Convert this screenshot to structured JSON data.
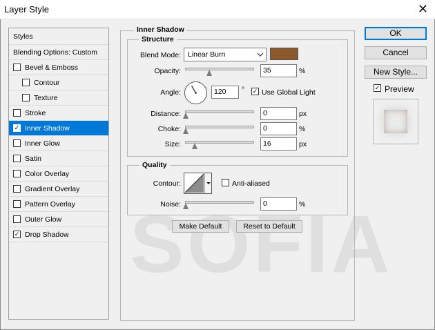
{
  "window": {
    "title": "Layer Style",
    "close_icon": "close-icon"
  },
  "left_list": {
    "styles_header": "Styles",
    "blending_options": "Blending Options: Custom",
    "items": [
      {
        "label": "Bevel & Emboss",
        "checked": false
      },
      {
        "label": "Contour",
        "checked": false
      },
      {
        "label": "Texture",
        "checked": false
      },
      {
        "label": "Stroke",
        "checked": false
      },
      {
        "label": "Inner Shadow",
        "checked": true
      },
      {
        "label": "Inner Glow",
        "checked": false
      },
      {
        "label": "Satin",
        "checked": false
      },
      {
        "label": "Color Overlay",
        "checked": false
      },
      {
        "label": "Gradient Overlay",
        "checked": false
      },
      {
        "label": "Pattern Overlay",
        "checked": false
      },
      {
        "label": "Outer Glow",
        "checked": false
      },
      {
        "label": "Drop Shadow",
        "checked": true
      }
    ]
  },
  "inner_shadow": {
    "section_title": "Inner Shadow",
    "structure": {
      "title": "Structure",
      "blend_mode_label": "Blend Mode:",
      "blend_mode_value": "Linear Burn",
      "blend_color": "#8a5a2e",
      "opacity_label": "Opacity:",
      "opacity_value": "35",
      "opacity_unit": "%",
      "opacity_level": 0.35,
      "angle_label": "Angle:",
      "angle_value": "120",
      "angle_unit": "°",
      "use_global_light_label": "Use Global Light",
      "use_global_light_checked": true,
      "distance_label": "Distance:",
      "distance_value": "0",
      "distance_unit": "px",
      "choke_label": "Choke:",
      "choke_value": "0",
      "choke_unit": "%",
      "size_label": "Size:",
      "size_value": "16",
      "size_unit": "px"
    },
    "quality": {
      "title": "Quality",
      "contour_label": "Contour:",
      "anti_aliased_label": "Anti-aliased",
      "anti_aliased_checked": false,
      "noise_label": "Noise:",
      "noise_value": "0",
      "noise_unit": "%"
    },
    "make_default": "Make Default",
    "reset_to_default": "Reset to Default"
  },
  "right_panel": {
    "ok": "OK",
    "cancel": "Cancel",
    "new_style": "New Style...",
    "preview_label": "Preview",
    "preview_checked": true
  },
  "watermark": "SOFIA",
  "colors": {
    "selected": "#0078d7",
    "accent_border": "#0078d7"
  }
}
